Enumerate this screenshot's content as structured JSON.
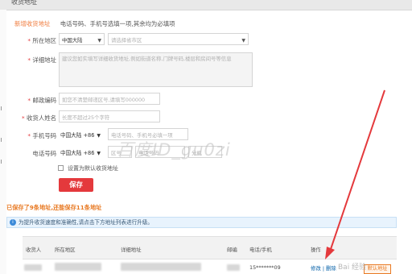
{
  "top_bar": {
    "title": "收货地址"
  },
  "section": {
    "title": "新增收货地址",
    "note": "电话号码、手机号选填一项,其余均为必填项"
  },
  "form": {
    "region": {
      "label": "所在地区",
      "country": "中国大陆",
      "placeholder": "请选择省市区"
    },
    "address": {
      "label": "详细地址",
      "placeholder": "建议您如实填写详细收货地址,例如街道名称,门牌号码,楼层和房间号等信息"
    },
    "zip": {
      "label": "邮政编码",
      "placeholder": "如您不清楚邮递区号,请填写000000"
    },
    "name": {
      "label": "收货人姓名",
      "placeholder": "长度不超过25个字符"
    },
    "mobile": {
      "label": "手机号码",
      "country": "中国大陆 +86",
      "placeholder": "电话号码、手机号必填一项"
    },
    "phone": {
      "label": "电话号码",
      "country": "中国大陆 +86",
      "area_placeholder": "区号",
      "number_placeholder": "电话号码",
      "ext_placeholder": "分机"
    },
    "default_checkbox_label": "设置为默认收货地址",
    "save_label": "保存"
  },
  "saved": {
    "prefix": "已保存了9条地址,",
    "suffix": "还能保存11条地址"
  },
  "notice": {
    "icon": "i",
    "text": "为提升收货速度和准确性,请点击下方地址列表进行升级。"
  },
  "table": {
    "columns": [
      "收货人",
      "所在地区",
      "详细地址",
      "邮编",
      "电话/手机",
      "操作"
    ],
    "row": {
      "phone": "15*******09",
      "actions": "修改 | 删除",
      "default_button": "默认地址"
    }
  },
  "watermark": "百度ID_gu0zi",
  "brand": "Bai 经验",
  "colors": {
    "accent_orange": "#f07b3c",
    "save_red": "#e4393c",
    "link_blue": "#005ea7",
    "notice_bg": "#e8f3fd"
  }
}
